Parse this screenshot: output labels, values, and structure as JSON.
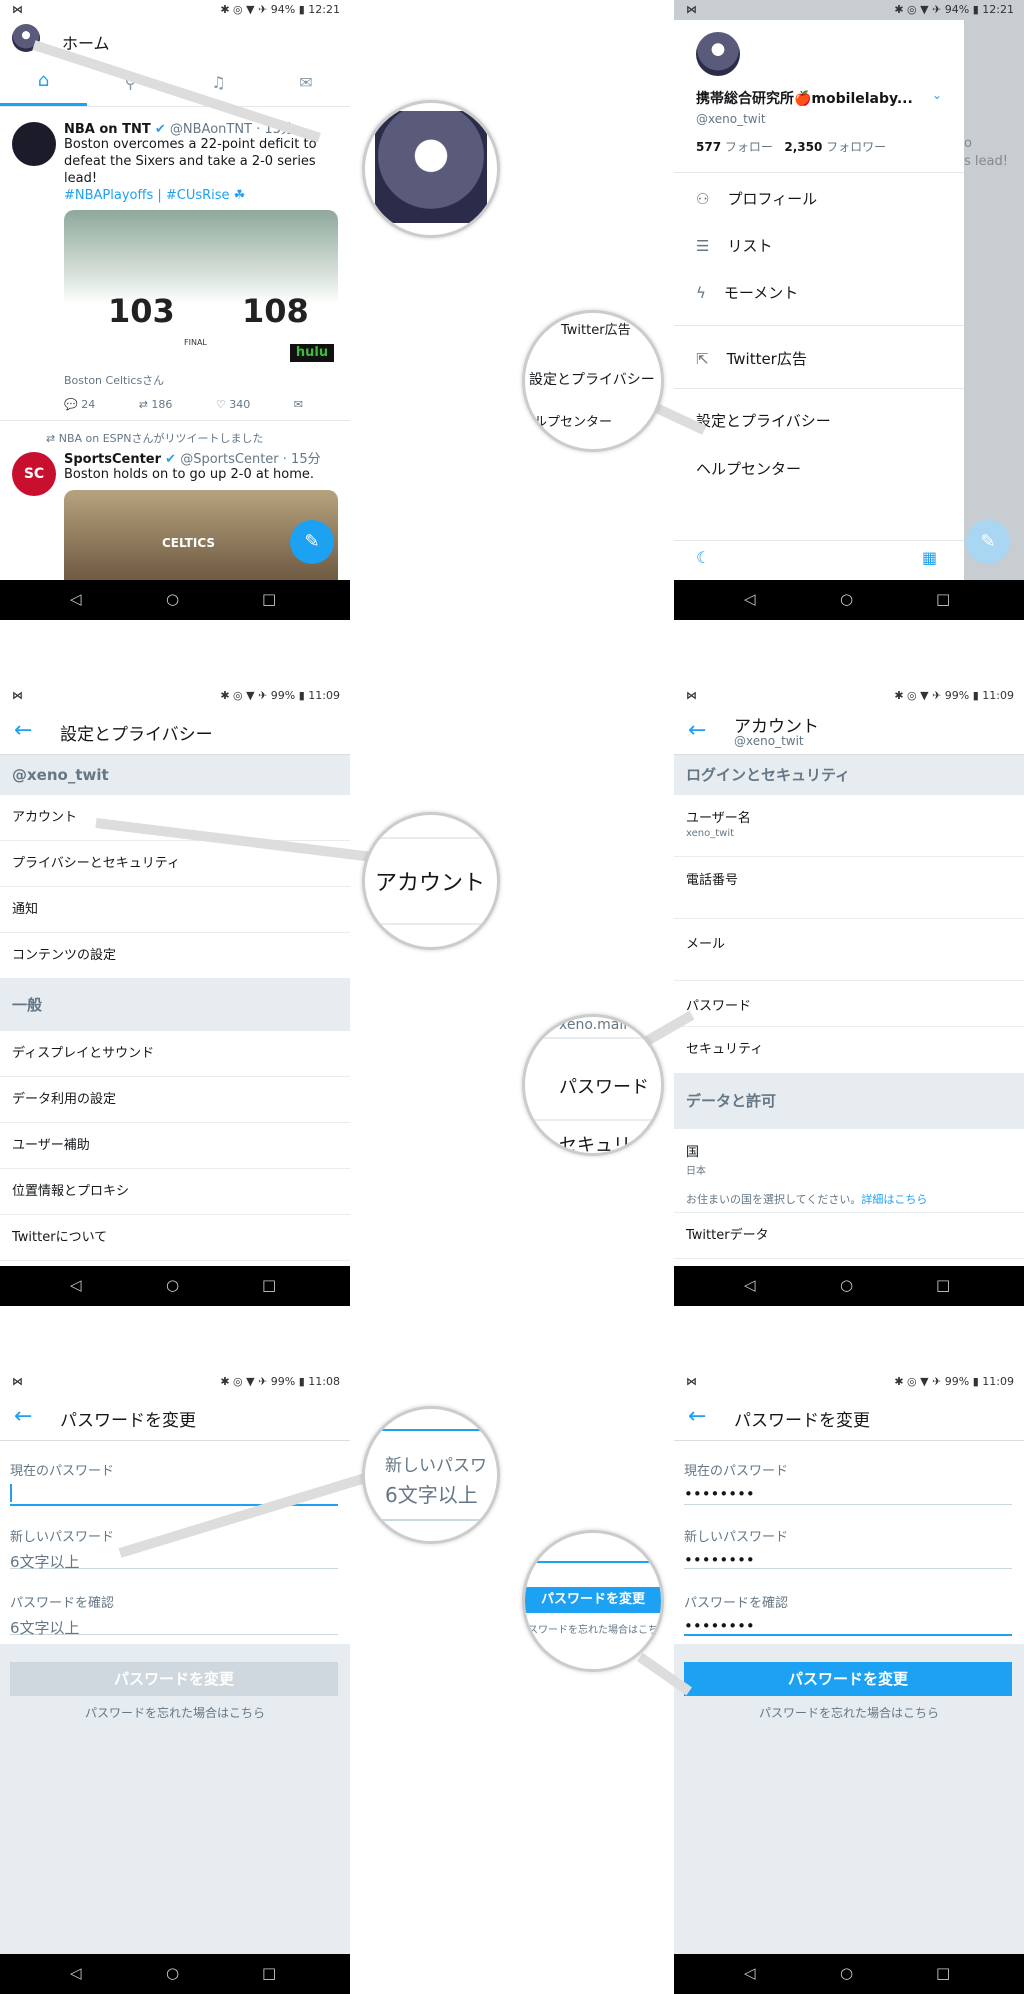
{
  "status": {
    "left_icon": "app-icon",
    "time_a": "12:21",
    "battery_a": "94%",
    "time_b": "11:09",
    "time_c": "11:08",
    "battery_b": "99%"
  },
  "home": {
    "title": "ホーム",
    "tabs": [
      "home-icon",
      "search-icon",
      "bell-icon",
      "mail-icon"
    ],
    "tweet1": {
      "name": "NBA on TNT",
      "handle": "@NBAonTNT · 13分",
      "text": "Boston overcomes a 22-point deficit to defeat the Sixers and take a 2-0 series lead!",
      "tags": "#NBAPlayoffs | #CUsRise ☘",
      "score_left": "103",
      "score_right": "108",
      "final": "FINAL",
      "hulu": "hulu",
      "liked_by": "Boston Celticsさん",
      "replies": "24",
      "retweets": "186",
      "likes": "340"
    },
    "retweet_note": "NBA on ESPNさんがリツイートしました",
    "tweet2": {
      "name": "SportsCenter",
      "handle": "@SportsCenter · 15分",
      "text": "Boston holds on to go up 2-0 at home.",
      "jersey": "CELTICS"
    }
  },
  "drawer": {
    "name": "携帯総合研究所🍎mobilelaby...",
    "handle": "@xeno_twit",
    "following_count": "577",
    "following_label": "フォロー",
    "followers_count": "2,350",
    "followers_label": "フォロワー",
    "items": [
      "プロフィール",
      "リスト",
      "モーメント"
    ],
    "ads": "Twitter広告",
    "settings": "設定とプライバシー",
    "help": "ヘルプセンター",
    "bg_text1": "o",
    "bg_text2": "s lead!"
  },
  "drawer_magnifier": {
    "line1": "Twitter広告",
    "line2": "設定とプライバシー",
    "line3": "ヘルプセンター"
  },
  "settings": {
    "title": "設定とプライバシー",
    "account_header": "@xeno_twit",
    "account_items": [
      "アカウント",
      "プライバシーとセキュリティ",
      "通知",
      "コンテンツの設定"
    ],
    "general_header": "一般",
    "general_items": [
      "ディスプレイとサウンド",
      "データ利用の設定",
      "ユーザー補助",
      "位置情報とプロキシ",
      "Twitterについて"
    ],
    "magnifier": "アカウント"
  },
  "account": {
    "title": "アカウント",
    "handle": "@xeno_twit",
    "login_header": "ログインとセキュリティ",
    "username_label": "ユーザー名",
    "username_value": "xeno_twit",
    "phone": "電話番号",
    "email": "メール",
    "password": "パスワード",
    "security": "セキュリティ",
    "data_header": "データと許可",
    "country_label": "国",
    "country_value": "日本",
    "country_note": "お住まいの国を選択してください。",
    "country_link": "詳細はこちら",
    "twitter_data": "Twitterデータ",
    "magnifier_top": "xeno.mail",
    "magnifier_mid": "パスワード",
    "magnifier_bottom": "セキュリ"
  },
  "change_pw": {
    "title": "パスワードを変更",
    "current_label": "現在のパスワード",
    "new_label": "新しいパスワード",
    "new_placeholder": "6文字以上",
    "confirm_label": "パスワードを確認",
    "confirm_placeholder": "6文字以上",
    "button": "パスワードを変更",
    "forgot": "パスワードを忘れた場合はこちら",
    "magnifier_label": "新しいパスワ",
    "magnifier_value": "6文字以上",
    "filled_current": "••••••••",
    "filled_new": "••••••••",
    "filled_confirm": "••••••••",
    "magnifier2_button": "パスワードを変更",
    "magnifier2_link": "スワードを忘れた場合はこち"
  },
  "colors": {
    "accent": "#1da1f2",
    "disabled": "#cfd8df",
    "section_bg": "#e6ecf0"
  }
}
